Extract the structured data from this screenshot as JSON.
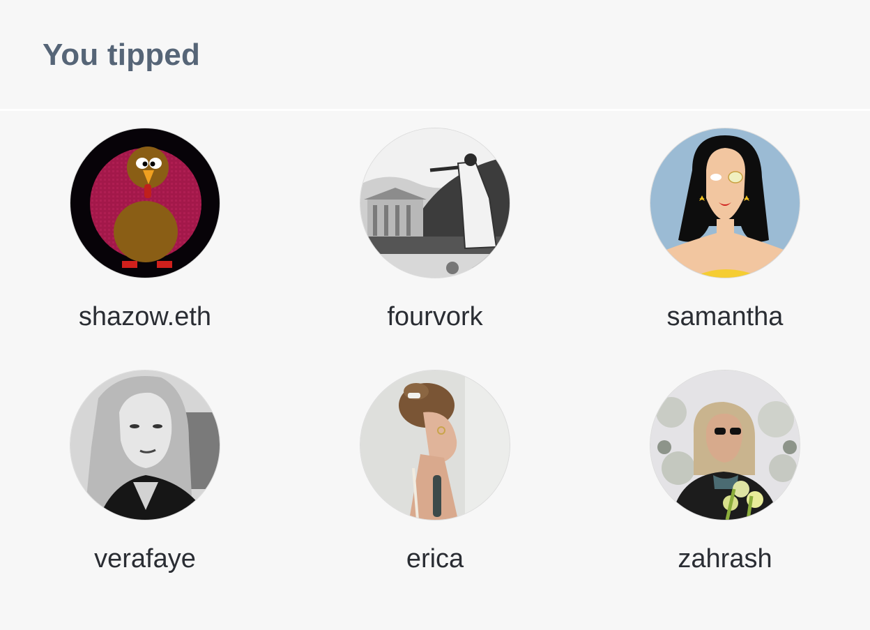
{
  "section": {
    "title": "You tipped"
  },
  "users": [
    {
      "name": "shazow.eth",
      "avatar": "turkey-avatar"
    },
    {
      "name": "fourvork",
      "avatar": "engraving-orator-avatar"
    },
    {
      "name": "samantha",
      "avatar": "illustrated-woman-avatar"
    },
    {
      "name": "verafaye",
      "avatar": "bw-portrait-avatar"
    },
    {
      "name": "erica",
      "avatar": "profile-photo-avatar"
    },
    {
      "name": "zahrash",
      "avatar": "snow-flowers-avatar"
    }
  ]
}
